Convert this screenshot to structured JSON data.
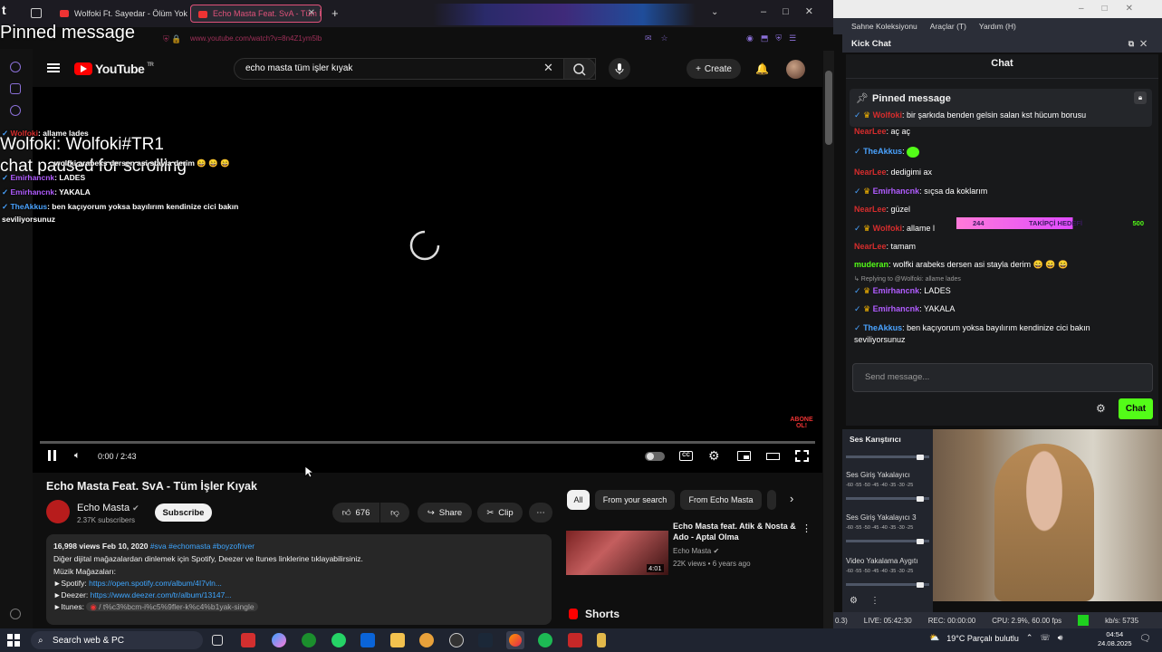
{
  "browser": {
    "tabs": [
      {
        "label": "Wolfoki Ft. Sayedar - Ölüm Yok"
      },
      {
        "label": "Echo Masta Feat. SvA - Tüm İşle"
      }
    ],
    "url": "www.youtube.com/watch?v=8n4Z1ym5lb",
    "overlay_title": "Pinned message"
  },
  "youtube": {
    "logo": "YouTube",
    "country": "TR",
    "search_value": "echo masta tüm işler kıyak",
    "create_label": "Create",
    "player": {
      "time": "0:00 / 2:43",
      "progress": 0.0
    },
    "overlay": {
      "title_line1": "Wolfoki: Wolfoki#TR1",
      "title_line2": "chat paused for scrolling",
      "lines": [
        {
          "name": "Wolfoki",
          "text": ": allame lades"
        },
        {
          "name": "",
          "text": "wolfki arabeks dersen asi stayla derim 😄 😄 😄"
        },
        {
          "name": "Emirhancnk",
          "text": ": LADES"
        },
        {
          "name": "Emirhancnk",
          "text": ": YAKALA"
        },
        {
          "name": "TheAkkus",
          "text": ": ben kaçıyorum yoksa bayılırım kendinize cici bakın"
        },
        {
          "name": "",
          "text": "seviliyorsunuz"
        }
      ],
      "abone_label": "ABONE OL!"
    },
    "video": {
      "title": "Echo Masta Feat. SvA - Tüm İşler Kıyak",
      "channel": "Echo Masta",
      "subscribers": "2.37K subscribers",
      "subscribe_label": "Subscribe",
      "likes": "676",
      "share_label": "Share",
      "clip_label": "Clip"
    },
    "description": {
      "meta": "16,998 views  Feb 10, 2020",
      "hashtags": "#sva #echomasta #boyzofriver",
      "line1": "Diğer dijital mağazalardan dinlemek için Spotify, Deezer ve Itunes linklerine tıklayabilirsiniz.",
      "line2": "Müzik Mağazaları:",
      "spotify_label": "►Spotify:",
      "spotify_url": "https://open.spotify.com/album/4I7vln...",
      "deezer_label": "►Deezer:",
      "deezer_url": "https://www.deezer.com/tr/album/13147...",
      "itunes_label": "►Itunes:",
      "itunes_url": "/ t%c3%bcm-i%c5%9fler-k%c4%b1yak-single"
    },
    "chips": [
      "All",
      "From your search",
      "From Echo Masta"
    ],
    "recommendation": {
      "title": "Echo Masta feat. Atik & Nosta & Ado - Aptal Olma",
      "channel": "Echo Masta",
      "meta": "22K views • 6 years ago",
      "duration": "4:01"
    },
    "shorts_label": "Shorts"
  },
  "obs": {
    "menu": [
      "Sahne Koleksiyonu",
      "Araçlar (T)",
      "Yardım (H)"
    ],
    "dock_title": "Kick Chat",
    "chat_title": "Chat",
    "pinned_header": "Pinned message",
    "pinned_text": {
      "name": "Wolfoki",
      "text": ": bir şarkıda benden gelsin salan kst hücum borusu"
    },
    "messages": [
      {
        "name": "NearLee",
        "text": ": aç aç"
      },
      {
        "name": "TheAkkus",
        "text": ":"
      },
      {
        "name": "NearLee",
        "text": ": dedigimi ax"
      },
      {
        "name": "Emirhancnk",
        "text": ": sıçsa da koklarım"
      },
      {
        "name": "NearLee",
        "text": ": güzel"
      },
      {
        "name": "Wolfoki",
        "text": ": allame l"
      },
      {
        "name": "NearLee",
        "text": ": tamam"
      },
      {
        "name": "muderan",
        "text": ": wolfki arabeks dersen asi stayla derim 😄 😄 😄"
      },
      {
        "name": "",
        "text": "↳ Replying to @Wolfoki: allame lades"
      },
      {
        "name": "Emirhancnk",
        "text": ": LADES"
      },
      {
        "name": "Emirhancnk",
        "text": ": YAKALA"
      },
      {
        "name": "TheAkkus",
        "text": ": ben kaçıyorum yoksa bayılırım kendinize cici bakın"
      },
      {
        "name": "",
        "text": "seviliyorsunuz"
      }
    ],
    "goal": {
      "start": "244",
      "label": "TAKİPÇİ HEDEFİ",
      "end": "500"
    },
    "send_placeholder": "Send message...",
    "send_label": "Chat",
    "mixer_title": "Ses Karıştırıcı",
    "mixer": [
      "Ses Giriş Yakalayıcı",
      "Ses Giriş Yakalayıcı 3",
      "Video Yakalama Aygıtı"
    ],
    "mixer_scale": "-60 -55 -50 -45 -40 -35 -30 -25",
    "status": {
      "left": "0.3)",
      "live": "LIVE: 05:42:30",
      "rec": "REC: 00:00:00",
      "cpu": "CPU: 2.9%, 60.00 fps",
      "kbs": "kb/s: 5735"
    }
  },
  "taskbar": {
    "search_placeholder": "Search web & PC",
    "weather": "19°C  Parçalı bulutlu",
    "time": "04:54",
    "date": "24.08.2025"
  }
}
